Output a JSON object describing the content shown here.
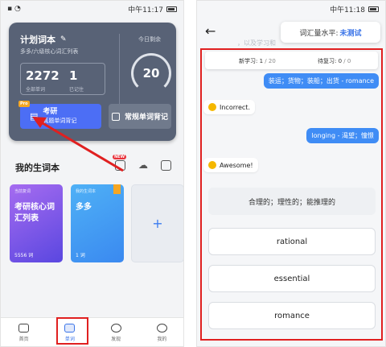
{
  "left": {
    "status": {
      "left": "",
      "time": "中午11:17"
    },
    "plan": {
      "title": "计划词本",
      "subtitle": "多多/六级核心词汇列表",
      "total_num": "2272",
      "total_label": "全部单词",
      "memorized_num": "1",
      "memorized_label": "已记住",
      "today_label": "今日剩余",
      "today_num": "20",
      "kaoyan_title": "考研",
      "kaoyan_sub": "真题单词背记",
      "pro_badge": "Pro",
      "regular_btn": "常规单词背记"
    },
    "vocab": {
      "title": "我的生词本",
      "new_badge": "NEW",
      "cards": [
        {
          "tag": "当前复词",
          "name": "考研核心词汇列表",
          "count": "5556 词"
        },
        {
          "tag": "我的生词本",
          "name": "多多",
          "count": "1 词"
        }
      ],
      "add": "+"
    },
    "tabs": [
      "首页",
      "单词",
      "发现",
      "我的"
    ]
  },
  "right": {
    "status": {
      "time": "中午11:18"
    },
    "level_label": "词汇量水平:",
    "level_value": "未测试",
    "ghost_text": "，以及学习和",
    "progress": {
      "new_label": "新学习:",
      "new_val": "1",
      "new_total": "/ 20",
      "review_label": "待复习:",
      "review_val": "0",
      "review_total": "/ 0"
    },
    "chat": [
      {
        "who": "me",
        "text": "装运；货物；装船；出货 - romance"
      },
      {
        "who": "bot",
        "text": "Incorrect."
      },
      {
        "who": "me",
        "text": "longing - 渴望；憧憬"
      },
      {
        "who": "bot",
        "text": "Awesome!"
      }
    ],
    "question": "合理的；理性的；能推理的",
    "options": [
      "rational",
      "essential",
      "romance"
    ]
  },
  "colors": {
    "accent": "#3a74e8",
    "highlight": "#e02020",
    "card_bg": "#586276"
  }
}
